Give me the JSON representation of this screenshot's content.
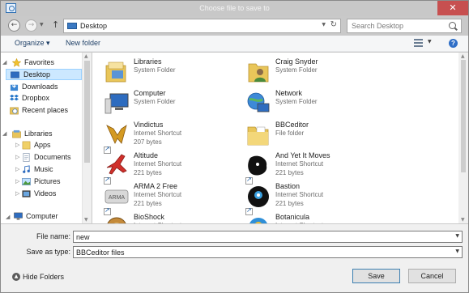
{
  "window": {
    "title": "Choose file to save to",
    "close_glyph": "✕"
  },
  "address": {
    "back_glyph": "←",
    "forward_glyph": "→",
    "up_glyph": "↑",
    "path": "Desktop",
    "search_placeholder": "Search Desktop"
  },
  "toolbar": {
    "organize": "Organize ▾",
    "new_folder": "New folder",
    "help": "?"
  },
  "nav": {
    "favorites": "Favorites",
    "desktop": "Desktop",
    "downloads": "Downloads",
    "dropbox": "Dropbox",
    "recent_places": "Recent places",
    "libraries": "Libraries",
    "apps": "Apps",
    "documents": "Documents",
    "music": "Music",
    "pictures": "Pictures",
    "videos": "Videos",
    "computer": "Computer"
  },
  "files": [
    {
      "name": "Libraries",
      "type": "System Folder",
      "size": "",
      "icon": "libraries-icon"
    },
    {
      "name": "Craig Snyder",
      "type": "System Folder",
      "size": "",
      "icon": "user-folder-icon"
    },
    {
      "name": "Computer",
      "type": "System Folder",
      "size": "",
      "icon": "computer-icon"
    },
    {
      "name": "Network",
      "type": "System Folder",
      "size": "",
      "icon": "network-icon"
    },
    {
      "name": "Vindictus",
      "type": "Internet Shortcut",
      "size": "207 bytes",
      "icon": "vindictus-icon"
    },
    {
      "name": "BBCeditor",
      "type": "File folder",
      "size": "",
      "icon": "folder-icon"
    },
    {
      "name": "Altitude",
      "type": "Internet Shortcut",
      "size": "221 bytes",
      "icon": "airplane-icon"
    },
    {
      "name": "And Yet It Moves",
      "type": "Internet Shortcut",
      "size": "221 bytes",
      "icon": "andyetitmoves-icon"
    },
    {
      "name": "ARMA 2 Free",
      "type": "Internet Shortcut",
      "size": "221 bytes",
      "icon": "arma-icon"
    },
    {
      "name": "Bastion",
      "type": "Internet Shortcut",
      "size": "221 bytes",
      "icon": "bastion-icon"
    },
    {
      "name": "BioShock",
      "type": "Internet Shortcut",
      "size": "",
      "icon": "bioshock-icon"
    },
    {
      "name": "Botanicula",
      "type": "Internet Shortcut",
      "size": "",
      "icon": "botanicula-icon"
    }
  ],
  "form": {
    "file_name_label": "File name:",
    "file_name_value": "new",
    "save_as_type_label": "Save as type:",
    "save_as_type_value": "BBCeditor files"
  },
  "footer": {
    "hide_folders": "Hide Folders",
    "save": "Save",
    "cancel": "Cancel"
  },
  "colors": {
    "accent": "#3c7fb1",
    "selection": "#cce8ff",
    "close": "#c75050"
  }
}
